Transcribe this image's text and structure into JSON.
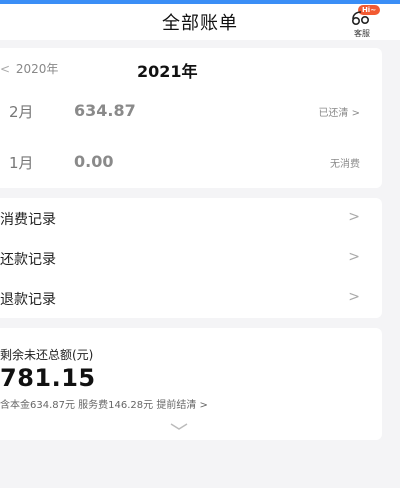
{
  "header": {
    "title": "全部账单",
    "customer_service": {
      "badge": "Hi~",
      "label": "客服"
    }
  },
  "bill": {
    "year_prev": "2020年",
    "year_prev_arrow": "<",
    "year_current": "2021年",
    "months": [
      {
        "month": "2月",
        "amount": "634.87",
        "status": "已还清 >"
      },
      {
        "month": "1月",
        "amount": "0.00",
        "status": "无消费"
      }
    ]
  },
  "records": [
    {
      "label": "消费记录",
      "chevron": ">"
    },
    {
      "label": "还款记录",
      "chevron": ">"
    },
    {
      "label": "退款记录",
      "chevron": ">"
    }
  ],
  "summary": {
    "label": "剩余未还总额(元)",
    "value": "781.15",
    "detail": "含本金634.87元 服务费146.28元 提前结清 >"
  },
  "colors": {
    "accent_bar": "#3a8ef6",
    "badge": "#f25a32"
  },
  "icons": [
    "customer-service-icon",
    "expand-chevron-icon"
  ]
}
